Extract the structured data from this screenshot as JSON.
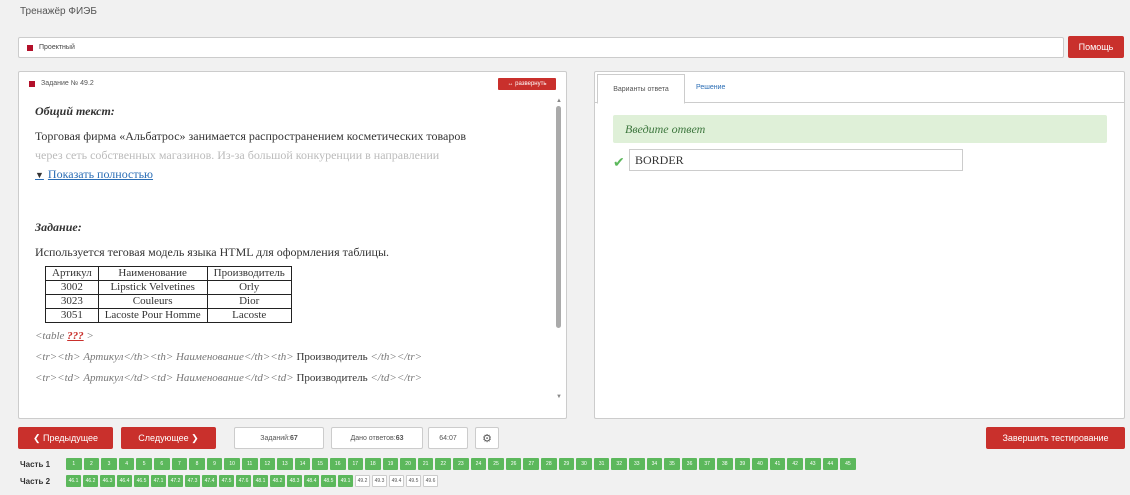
{
  "app_title": "Тренажёр ФИЭБ",
  "top": {
    "section_label": "Проектный",
    "help_label": "Помощь"
  },
  "task": {
    "header": "Задание № 49.2",
    "expand_label": "↔ развернуть",
    "common_title": "Общий текст:",
    "common_line1": "Торговая фирма «Альбатрос» занимается распространением косметических товаров",
    "common_line2": "через сеть собственных магазинов. Из-за большой конкуренции в направлении",
    "show_more": "Показать полностью",
    "task_title": "Задание:",
    "task_text": "Используется теговая модель языка HTML для оформления таблицы.",
    "table": {
      "headers": [
        "Артикул",
        "Наименование",
        "Производитель"
      ],
      "rows": [
        [
          "3002",
          "Lipstick Velvetines",
          "Orly"
        ],
        [
          "3023",
          "Couleurs",
          "Dior"
        ],
        [
          "3051",
          "Lacoste Pour Homme",
          "Lacoste"
        ]
      ]
    },
    "code_line1_a": "<table ",
    "code_line1_b": "???",
    "code_line1_c": " >",
    "code_line2_a": "<tr><th> Артикул</th><th> Наименование</th><th> ",
    "code_line2_b": "Производитель",
    "code_line2_c": " </th></tr>",
    "code_line3_a": "<tr><td> Артикул</td><td> Наименование</td><td> ",
    "code_line3_b": "Производитель",
    "code_line3_c": " </td></tr>"
  },
  "answer": {
    "tab_variants": "Варианты ответа",
    "tab_solution": "Решение",
    "prompt": "Введите ответ",
    "value": "BORDER"
  },
  "footer": {
    "prev_label": "❮ Предыдущее",
    "next_label": "Следующее ❯",
    "tasks_label": "Заданий: ",
    "tasks_count": "67",
    "answered_label": "Дано ответов: ",
    "answered_count": "63",
    "timer": "64:07",
    "gear_icon": "gear-icon",
    "finish_label": "Завершить тестирование"
  },
  "parts": {
    "part1_label": "Часть 1",
    "part2_label": "Часть 2",
    "part1_cells": [
      "1",
      "2",
      "3",
      "4",
      "5",
      "6",
      "7",
      "8",
      "9",
      "10",
      "11",
      "12",
      "13",
      "14",
      "15",
      "16",
      "17",
      "18",
      "19",
      "20",
      "21",
      "22",
      "23",
      "24",
      "25",
      "26",
      "27",
      "28",
      "29",
      "30",
      "31",
      "32",
      "33",
      "34",
      "35",
      "36",
      "37",
      "38",
      "39",
      "40",
      "41",
      "42",
      "43",
      "44",
      "45"
    ],
    "part2_cells": [
      {
        "label": "46.1",
        "state": "answered"
      },
      {
        "label": "46.2",
        "state": "answered"
      },
      {
        "label": "46.3",
        "state": "answered"
      },
      {
        "label": "46.4",
        "state": "answered"
      },
      {
        "label": "46.5",
        "state": "answered"
      },
      {
        "label": "47.1",
        "state": "answered"
      },
      {
        "label": "47.2",
        "state": "answered"
      },
      {
        "label": "47.3",
        "state": "answered"
      },
      {
        "label": "47.4",
        "state": "answered"
      },
      {
        "label": "47.5",
        "state": "answered"
      },
      {
        "label": "47.6",
        "state": "answered"
      },
      {
        "label": "48.1",
        "state": "answered"
      },
      {
        "label": "48.2",
        "state": "answered"
      },
      {
        "label": "48.3",
        "state": "answered"
      },
      {
        "label": "48.4",
        "state": "answered"
      },
      {
        "label": "48.5",
        "state": "answered"
      },
      {
        "label": "49.1",
        "state": "answered"
      },
      {
        "label": "49.2",
        "state": "unanswered"
      },
      {
        "label": "49.3",
        "state": "unanswered"
      },
      {
        "label": "49.4",
        "state": "unanswered"
      },
      {
        "label": "49.5",
        "state": "unanswered"
      },
      {
        "label": "49.6",
        "state": "unanswered"
      }
    ]
  },
  "colors": {
    "accent_red": "#c9302c",
    "answered_green": "#5cb85c",
    "prompt_bg": "#dff0d8"
  }
}
